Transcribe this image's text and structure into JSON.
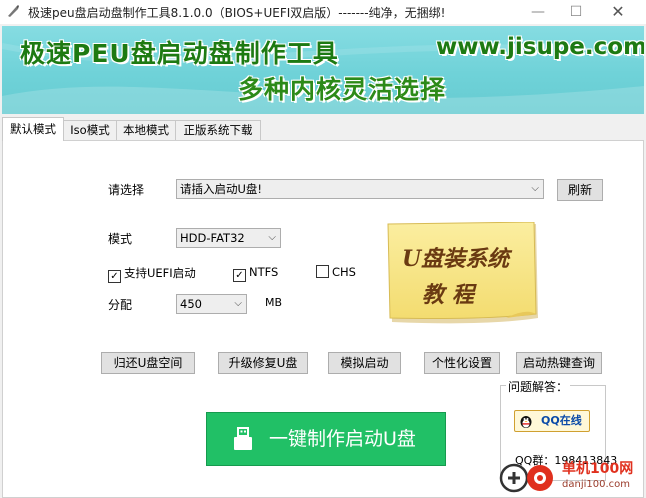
{
  "window": {
    "title": "极速peu盘启动盘制作工具8.1.0.0（BIOS+UEFI双启版）-------纯净，无捆绑!",
    "min_symbol": "—",
    "max_symbol": "☐",
    "close_symbol": "✕"
  },
  "banner": {
    "title": "极速PEU盘启动盘制作工具",
    "url": "www.jisupe.com",
    "slogan": "多种内核灵活选择"
  },
  "tabs": [
    {
      "label": "默认模式",
      "active": true
    },
    {
      "label": "Iso模式",
      "active": false
    },
    {
      "label": "本地模式",
      "active": false
    },
    {
      "label": "正版系统下载",
      "active": false
    }
  ],
  "form": {
    "select_label": "请选择",
    "usb_value": "请插入启动U盘!",
    "refresh_label": "刷新",
    "mode_label": "模式",
    "mode_value": "HDD-FAT32",
    "uefi_label": "支持UEFI启动",
    "uefi_checked": true,
    "ntfs_label": "NTFS",
    "ntfs_checked": true,
    "chs_label": "CHS",
    "chs_checked": false,
    "partition_label": "分配",
    "partition_value": "450",
    "partition_unit": "MB"
  },
  "sticky_note": {
    "line1": "U盘装系统",
    "line2": "教程"
  },
  "actions": {
    "restore": "归还U盘空间",
    "upgrade": "升级修复U盘",
    "simulate": "模拟启动",
    "personalize": "个性化设置",
    "hotkey": "启动热键查询"
  },
  "qa": {
    "title": "问题解答：",
    "qq_button": "QQ在线",
    "qq_group": "QQ群：198413843"
  },
  "make_button_label": "一键制作启动U盘",
  "watermark": {
    "name": "单机100网",
    "url": "danji100.com"
  },
  "colors": {
    "banner_bg": "#6fd2d8",
    "banner_text": "#1d7a12",
    "make_button": "#21c066",
    "sticky_note": "#f7e58a",
    "sticky_text": "#6a3a12"
  }
}
